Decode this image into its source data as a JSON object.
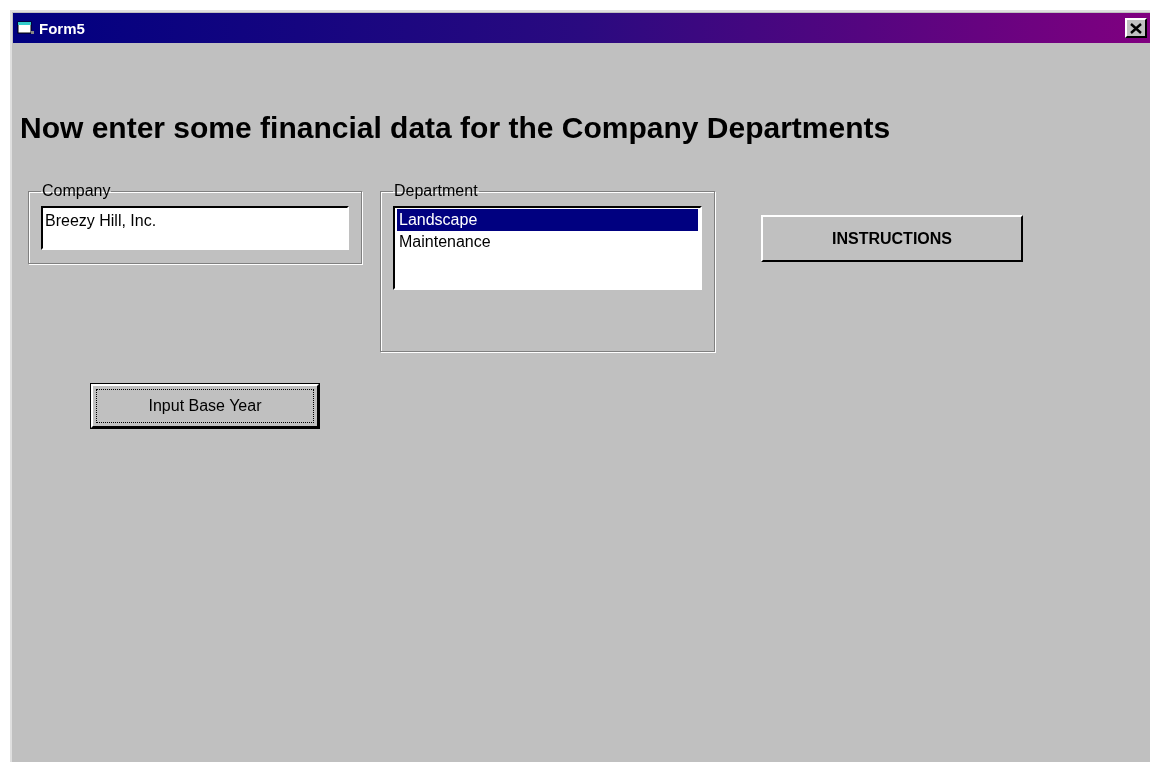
{
  "window": {
    "title": "Form5"
  },
  "heading": "Now enter some financial data for the Company Departments",
  "company": {
    "label": "Company",
    "value": "Breezy Hill, Inc."
  },
  "department": {
    "label": "Department",
    "items": [
      {
        "label": "Landscape",
        "selected": true
      },
      {
        "label": "Maintenance",
        "selected": false
      }
    ]
  },
  "buttons": [
    {
      "label": "INSTRUCTIONS",
      "kind": "bold"
    },
    {
      "label": "Input Base Year",
      "kind": "focused"
    }
  ]
}
